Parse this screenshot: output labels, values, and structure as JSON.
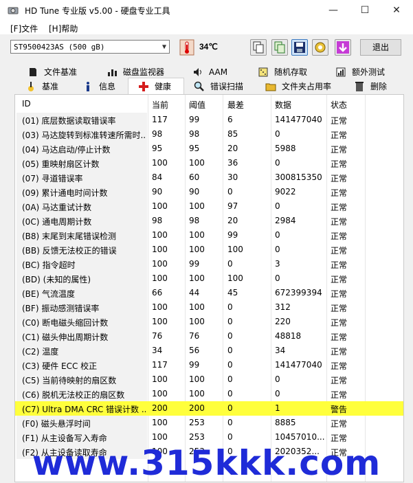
{
  "window": {
    "title": "HD Tune 专业版 v5.00 - 硬盘专业工具",
    "min": "—",
    "max": "☐",
    "close": "✕"
  },
  "menu": {
    "file": "[F]文件",
    "help": "[H]帮助"
  },
  "toolbar": {
    "drive": "ST9500423AS (500 gB)",
    "temperature": "34℃",
    "exit": "退出",
    "buttons": [
      "copy-text-icon",
      "copy-screen-icon",
      "save-icon",
      "options-icon",
      "download-icon"
    ]
  },
  "tabs": {
    "row1": [
      {
        "label": "文件基准",
        "icon": "file-benchmark-icon"
      },
      {
        "label": "磁盘监视器",
        "icon": "disk-monitor-icon"
      },
      {
        "label": "AAM",
        "icon": "speaker-icon"
      },
      {
        "label": "随机存取",
        "icon": "random-access-icon"
      },
      {
        "label": "额外测试",
        "icon": "extra-tests-icon"
      }
    ],
    "row2": [
      {
        "label": "基准",
        "icon": "benchmark-icon"
      },
      {
        "label": "信息",
        "icon": "info-icon"
      },
      {
        "label": "健康",
        "icon": "health-icon"
      },
      {
        "label": "错误扫描",
        "icon": "error-scan-icon"
      },
      {
        "label": "文件夹占用率",
        "icon": "folder-usage-icon"
      },
      {
        "label": "删除",
        "icon": "erase-icon"
      }
    ]
  },
  "health": {
    "columns": [
      "ID",
      "当前",
      "阈值",
      "最差",
      "数据",
      "状态"
    ],
    "rows": [
      [
        "(01) 底层数据读取错误率",
        "117",
        "99",
        "6",
        "141477040",
        "正常"
      ],
      [
        "(03) 马达旋转到标准转速所需时...",
        "98",
        "98",
        "85",
        "0",
        "正常"
      ],
      [
        "(04) 马达启动/停止计数",
        "95",
        "95",
        "20",
        "5988",
        "正常"
      ],
      [
        "(05) 重映射扇区计数",
        "100",
        "100",
        "36",
        "0",
        "正常"
      ],
      [
        "(07) 寻道错误率",
        "84",
        "60",
        "30",
        "300815350",
        "正常"
      ],
      [
        "(09) 累计通电时间计数",
        "90",
        "90",
        "0",
        "9022",
        "正常"
      ],
      [
        "(0A) 马达重试计数",
        "100",
        "100",
        "97",
        "0",
        "正常"
      ],
      [
        "(0C) 通电周期计数",
        "98",
        "98",
        "20",
        "2984",
        "正常"
      ],
      [
        "(B8) 末尾到末尾错误检测",
        "100",
        "100",
        "99",
        "0",
        "正常"
      ],
      [
        "(BB) 反馈无法校正的错误",
        "100",
        "100",
        "100",
        "0",
        "正常"
      ],
      [
        "(BC) 指令超时",
        "100",
        "99",
        "0",
        "3",
        "正常"
      ],
      [
        "(BD) (未知的属性)",
        "100",
        "100",
        "100",
        "0",
        "正常"
      ],
      [
        "(BE) 气流温度",
        "66",
        "44",
        "45",
        "672399394",
        "正常"
      ],
      [
        "(BF) 振动感测错误率",
        "100",
        "100",
        "0",
        "312",
        "正常"
      ],
      [
        "(C0) 断电磁头缩回计数",
        "100",
        "100",
        "0",
        "220",
        "正常"
      ],
      [
        "(C1) 磁头伸出周期计数",
        "76",
        "76",
        "0",
        "48818",
        "正常"
      ],
      [
        "(C2) 温度",
        "34",
        "56",
        "0",
        "34",
        "正常"
      ],
      [
        "(C3) 硬件 ECC 校正",
        "117",
        "99",
        "0",
        "141477040",
        "正常"
      ],
      [
        "(C5) 当前待映射的扇区数",
        "100",
        "100",
        "0",
        "0",
        "正常"
      ],
      [
        "(C6) 脱机无法校正的扇区数",
        "100",
        "100",
        "0",
        "0",
        "正常"
      ],
      [
        "(C7) Ultra DMA CRC 错误计数 ...",
        "200",
        "200",
        "0",
        "1",
        "警告"
      ],
      [
        "(F0) 磁头悬浮时间",
        "100",
        "253",
        "0",
        "8885",
        "正常"
      ],
      [
        "(F1) 从主设备写入寿命",
        "100",
        "253",
        "0",
        "10457010...",
        "正常"
      ],
      [
        "(F2) 从主设备读取寿命",
        "100",
        "253",
        "0",
        "2020352...",
        "正常"
      ]
    ],
    "warning_row_index": 20
  },
  "watermark": "www.315kkk.com",
  "colors": {
    "warning_highlight": "#ffff3c",
    "watermark": "#1f2bd8"
  }
}
